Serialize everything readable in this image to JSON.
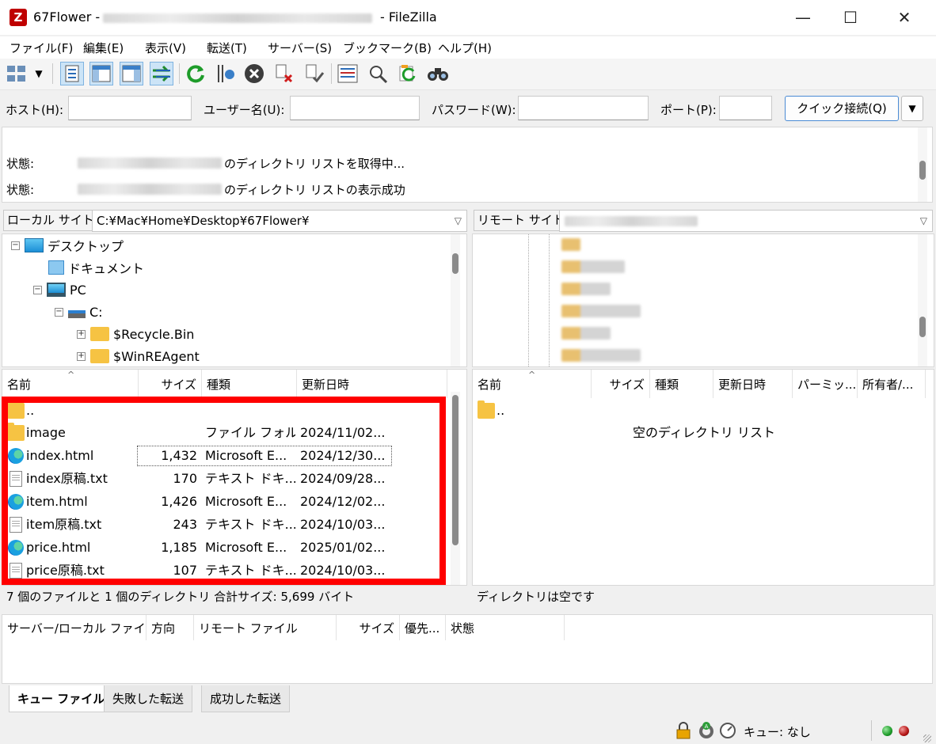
{
  "window": {
    "title_prefix": "67Flower -",
    "title_suffix": "- FileZilla",
    "app_icon_letter": "Z",
    "minimize": "—",
    "maximize": "☐",
    "close": "✕"
  },
  "menu": [
    "ファイル(F)",
    "編集(E)",
    "表示(V)",
    "転送(T)",
    "サーバー(S)",
    "ブックマーク(B)",
    "ヘルプ(H)"
  ],
  "quickconnect": {
    "host_label": "ホスト(H):",
    "user_label": "ユーザー名(U):",
    "password_label": "パスワード(W):",
    "port_label": "ポート(P):",
    "host_value": "",
    "user_value": "",
    "password_value": "",
    "port_value": "",
    "button": "クイック接続(Q)",
    "dropdown": "▼"
  },
  "log": [
    {
      "label": "状態:",
      "message": "のディレクトリ リストを取得中..."
    },
    {
      "label": "状態:",
      "message": "のディレクトリ リストの表示成功"
    }
  ],
  "local": {
    "site_label": "ローカル サイト:",
    "path": "C:¥Mac¥Home¥Desktop¥67Flower¥",
    "tree": [
      {
        "label": "デスクトップ",
        "expander": "−"
      },
      {
        "label": "ドキュメント",
        "expander": ""
      },
      {
        "label": "PC",
        "expander": "−"
      },
      {
        "label": "C:",
        "expander": "−"
      },
      {
        "label": "$Recycle.Bin",
        "expander": "+"
      },
      {
        "label": "$WinREAgent",
        "expander": "+"
      }
    ],
    "columns": [
      "名前",
      "サイズ",
      "種類",
      "更新日時"
    ],
    "files": [
      {
        "name": "..",
        "size": "",
        "type": "",
        "modified": "",
        "icon": "folder"
      },
      {
        "name": "image",
        "size": "",
        "type": "ファイル フォル...",
        "modified": "2024/11/02...",
        "icon": "folder"
      },
      {
        "name": "index.html",
        "size": "1,432",
        "type": "Microsoft E...",
        "modified": "2024/12/30...",
        "icon": "edge"
      },
      {
        "name": "index原稿.txt",
        "size": "170",
        "type": "テキスト ドキ...",
        "modified": "2024/09/28...",
        "icon": "doc"
      },
      {
        "name": "item.html",
        "size": "1,426",
        "type": "Microsoft E...",
        "modified": "2024/12/02...",
        "icon": "edge"
      },
      {
        "name": "item原稿.txt",
        "size": "243",
        "type": "テキスト ドキ...",
        "modified": "2024/10/03...",
        "icon": "doc"
      },
      {
        "name": "price.html",
        "size": "1,185",
        "type": "Microsoft E...",
        "modified": "2025/01/02...",
        "icon": "edge"
      },
      {
        "name": "price原稿.txt",
        "size": "107",
        "type": "テキスト ドキ...",
        "modified": "2024/10/03...",
        "icon": "doc"
      }
    ],
    "status": "7 個のファイルと 1 個のディレクトリ 合計サイズ: 5,699 バイト"
  },
  "remote": {
    "site_label": "リモート サイト:",
    "columns": [
      "名前",
      "サイズ",
      "種類",
      "更新日時",
      "パーミッ...",
      "所有者/..."
    ],
    "files": [
      {
        "name": "..",
        "icon": "folder"
      }
    ],
    "empty_message": "空のディレクトリ リスト",
    "status": "ディレクトリは空です"
  },
  "queue": {
    "columns": [
      "サーバー/ローカル ファイ...",
      "方向",
      "リモート ファイル",
      "サイズ",
      "優先...",
      "状態"
    ],
    "tabs": [
      "キュー ファイル",
      "失敗した転送",
      "成功した転送"
    ],
    "status": "キュー: なし"
  },
  "colors": {
    "highlight": "#ff0000",
    "accent": "#4a8bd4",
    "led_green": "#1e9c2a",
    "led_red": "#b41414"
  }
}
